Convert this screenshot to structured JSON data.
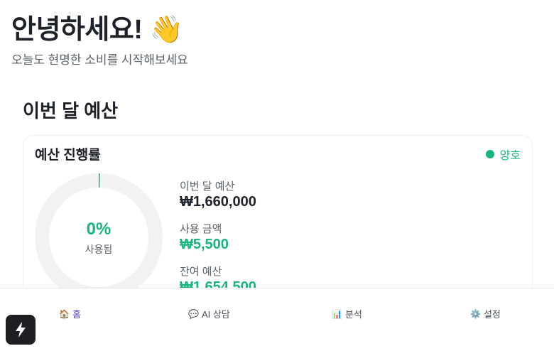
{
  "header": {
    "greeting": "안녕하세요! 👋",
    "subtitle": "오늘도 현명한 소비를 시작해보세요"
  },
  "budget_section": {
    "title": "이번 달 예산",
    "card": {
      "title": "예산 진행률",
      "status_label": "양호",
      "progress_percent_label": "0%",
      "progress_value": 0.003,
      "progress_caption": "사용됨",
      "stats": [
        {
          "label": "이번 달 예산",
          "value": "₩1,660,000"
        },
        {
          "label": "사용 금액",
          "value": "₩5,500"
        },
        {
          "label": "잔여 예산",
          "value": "₩1,654,500"
        }
      ]
    }
  },
  "nav": {
    "items": [
      {
        "icon": "🏠",
        "label": "홈",
        "active": true
      },
      {
        "icon": "💬",
        "label": "AI 상담",
        "active": false
      },
      {
        "icon": "📊",
        "label": "분석",
        "active": false
      },
      {
        "icon": "⚙️",
        "label": "설정",
        "active": false
      }
    ]
  },
  "colors": {
    "accent_green": "#16b67d",
    "active_nav": "#5a45c4",
    "ring_track": "#f1f2f4"
  }
}
